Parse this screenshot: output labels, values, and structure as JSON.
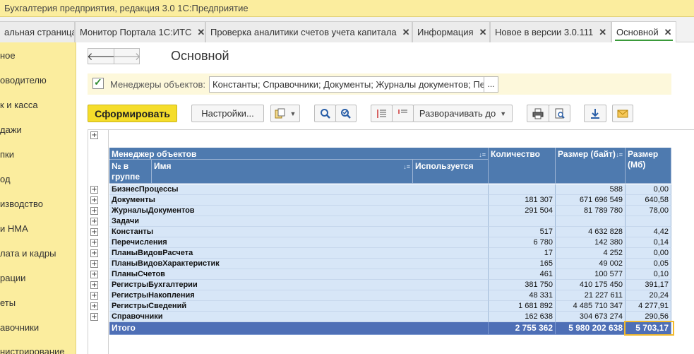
{
  "window": {
    "title": "Бухгалтерия предприятия, редакция 3.0 1С:Предприятие"
  },
  "tabs": [
    {
      "label": "альная страница",
      "close": ""
    },
    {
      "label": "Монитор Портала 1С:ИТС",
      "close": "✕"
    },
    {
      "label": "Проверка аналитики счетов учета капитала",
      "close": "✕"
    },
    {
      "label": "Информация",
      "close": "✕"
    },
    {
      "label": "Новое в версии 3.0.111",
      "close": "✕"
    },
    {
      "label": "Основной",
      "close": "✕"
    }
  ],
  "sidebar": {
    "items": [
      "ное",
      "оводителю",
      "к и касса",
      "дажи",
      "пки",
      "од",
      "изводство",
      "и НМА",
      "лата и кадры",
      "рации",
      "еты",
      "авочники",
      "нистрирование"
    ]
  },
  "nav": {
    "back": "🡐",
    "forward": "🡒"
  },
  "page": {
    "title": "Основной"
  },
  "params": {
    "checkbox_label": "Менеджеры объектов:",
    "value": "Константы; Справочники; Документы; Журналы документов; Пе",
    "more": "..."
  },
  "toolbar": {
    "generate": "Сформировать",
    "settings": "Настройки...",
    "expand_to": "Разворачивать до",
    "icons": [
      "copy-icon",
      "search-icon",
      "search-next-icon",
      "collapse-groups-icon",
      "expand-groups-icon",
      "print-icon",
      "print-preview-icon",
      "download-icon",
      "mail-icon"
    ]
  },
  "table": {
    "headers": {
      "manager": "Менеджер объектов",
      "group_no": "№ в группе",
      "name": "Имя",
      "used": "Используется",
      "count": "Количество",
      "size_bytes": "Размер (байт)",
      "size_mb": "Размер (Мб)"
    },
    "rows": [
      {
        "name": "БизнесПроцессы",
        "count": "",
        "bytes": "588",
        "mb": "0,00"
      },
      {
        "name": "Документы",
        "count": "181 307",
        "bytes": "671 696 549",
        "mb": "640,58"
      },
      {
        "name": "ЖурналыДокументов",
        "count": "291 504",
        "bytes": "81 789 780",
        "mb": "78,00"
      },
      {
        "name": "Задачи",
        "count": "",
        "bytes": "",
        "mb": ""
      },
      {
        "name": "Константы",
        "count": "517",
        "bytes": "4 632 828",
        "mb": "4,42"
      },
      {
        "name": "Перечисления",
        "count": "6 780",
        "bytes": "142 380",
        "mb": "0,14"
      },
      {
        "name": "ПланыВидовРасчета",
        "count": "17",
        "bytes": "4 252",
        "mb": "0,00"
      },
      {
        "name": "ПланыВидовХарактеристик",
        "count": "165",
        "bytes": "49 002",
        "mb": "0,05"
      },
      {
        "name": "ПланыСчетов",
        "count": "461",
        "bytes": "100 577",
        "mb": "0,10"
      },
      {
        "name": "РегистрыБухгалтерии",
        "count": "381 750",
        "bytes": "410 175 450",
        "mb": "391,17"
      },
      {
        "name": "РегистрыНакопления",
        "count": "48 331",
        "bytes": "21 227 611",
        "mb": "20,24"
      },
      {
        "name": "РегистрыСведений",
        "count": "1 681 892",
        "bytes": "4 485 710 347",
        "mb": "4 277,91"
      },
      {
        "name": "Справочники",
        "count": "162 638",
        "bytes": "304 673 274",
        "mb": "290,56"
      }
    ],
    "total": {
      "label": "Итого",
      "count": "2 755 362",
      "bytes": "5 980 202 638",
      "mb": "5 703,17"
    }
  }
}
